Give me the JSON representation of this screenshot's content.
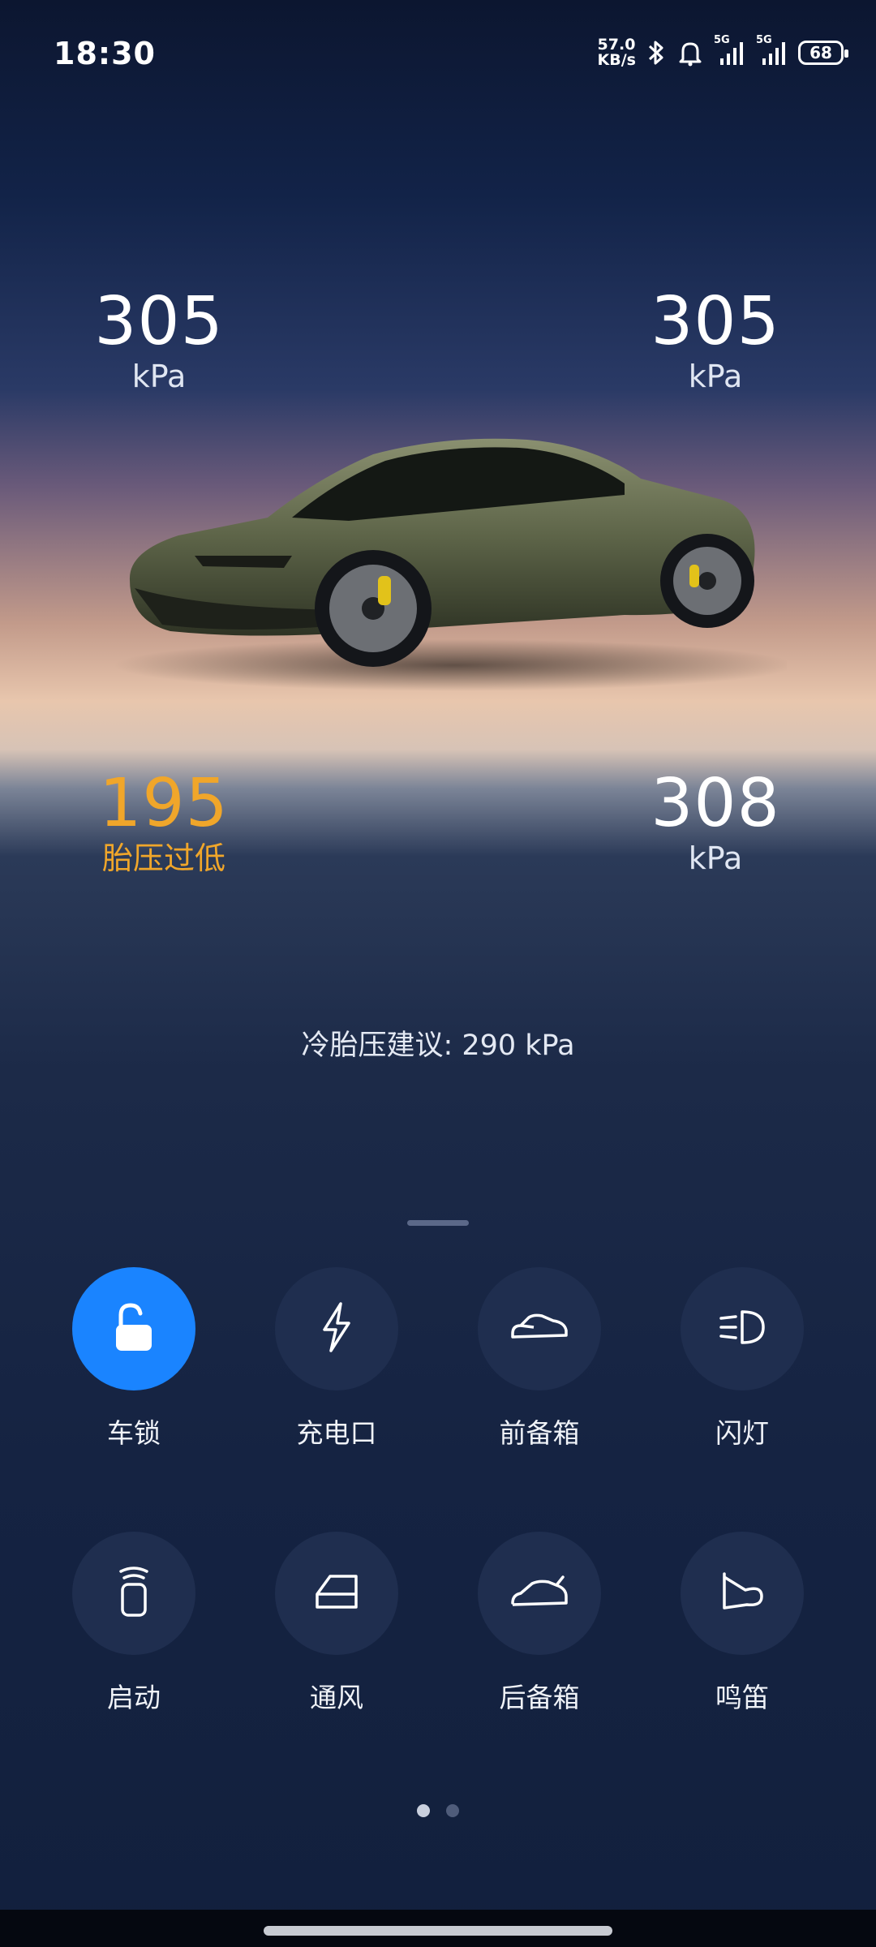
{
  "status_bar": {
    "time": "18:30",
    "net_speed_value": "57.0",
    "net_speed_unit": "KB/s",
    "signal1_label": "5G",
    "signal2_label": "5G",
    "battery": "68"
  },
  "tires": {
    "front_left": {
      "value": "305",
      "unit": "kPa"
    },
    "front_right": {
      "value": "305",
      "unit": "kPa"
    },
    "rear_left": {
      "value": "195",
      "status": "胎压过低",
      "color": "#f0a62a"
    },
    "rear_right": {
      "value": "308",
      "unit": "kPa"
    }
  },
  "advice": "冷胎压建议: 290 kPa",
  "controls": [
    {
      "label": "车锁",
      "icon": "unlock-icon",
      "active": true,
      "accent": "#1a84ff"
    },
    {
      "label": "充电口",
      "icon": "lightning-icon",
      "active": false
    },
    {
      "label": "前备箱",
      "icon": "front-trunk-icon",
      "active": false
    },
    {
      "label": "闪灯",
      "icon": "headlight-icon",
      "active": false
    },
    {
      "label": "启动",
      "icon": "start-icon",
      "active": false
    },
    {
      "label": "通风",
      "icon": "window-icon",
      "active": false
    },
    {
      "label": "后备箱",
      "icon": "rear-trunk-icon",
      "active": false
    },
    {
      "label": "鸣笛",
      "icon": "horn-icon",
      "active": false
    }
  ],
  "pager": {
    "pages": 2,
    "current": 1
  }
}
